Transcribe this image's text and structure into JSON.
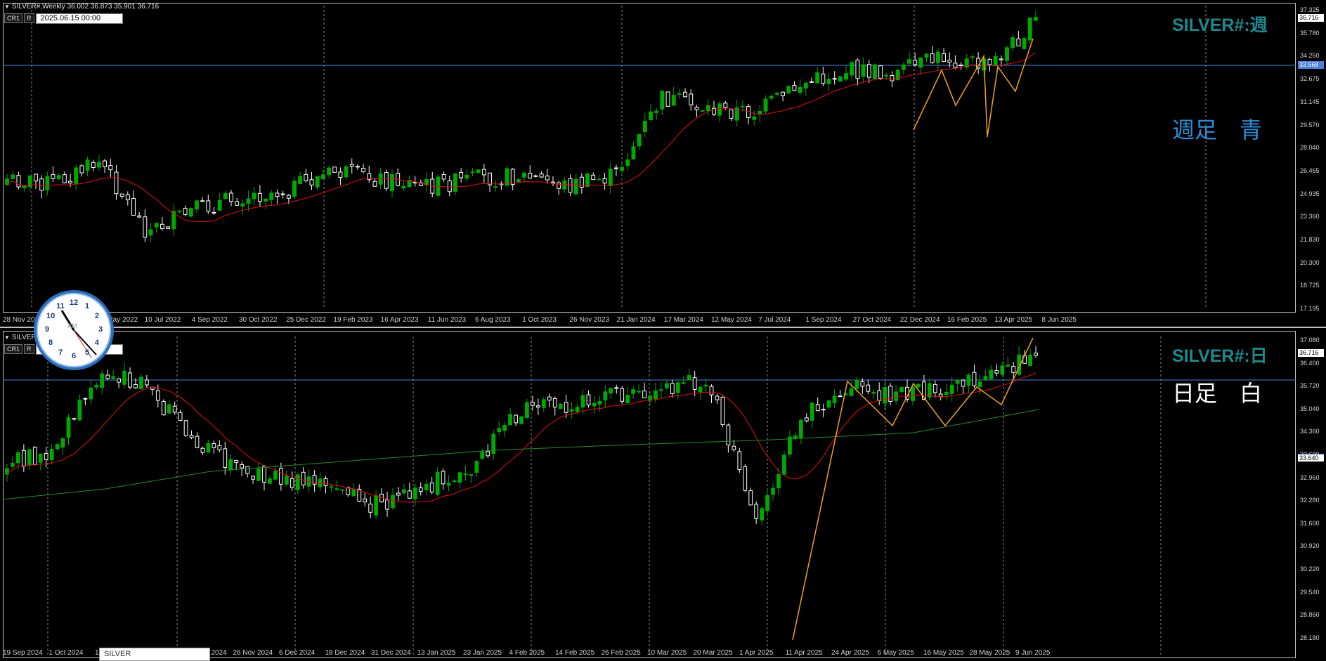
{
  "weekly": {
    "header": "SILVER#,Weekly  36.002 36.873 35.901 36.716",
    "buttons": [
      "CR1",
      "R"
    ],
    "date_input": "2025.06.15 00:00",
    "title_tag": "SILVER#:週",
    "note": "週足　青",
    "note_color": "#2b8cd6",
    "price_labels": [
      "37.325",
      "35.780",
      "34.250",
      "32.675",
      "31.145",
      "29.570",
      "28.040",
      "26.465",
      "24.935",
      "23.360",
      "21.830",
      "20.300",
      "18.725",
      "17.195"
    ],
    "price_tags": [
      "36.716",
      "33.568"
    ],
    "time_labels": [
      "28 Nov 2021",
      "2022",
      "15 May 2022",
      "10 Jul 2022",
      "4 Sep 2022",
      "30 Oct 2022",
      "25 Dec 2022",
      "19 Feb 2023",
      "16 Apr 2023",
      "11 Jun 2023",
      "6 Aug 2023",
      "1 Oct 2023",
      "26 Nov 2023",
      "21 Jan 2024",
      "17 Mar 2024",
      "12 May 2024",
      "7 Jul 2024",
      "1 Sep 2024",
      "27 Oct 2024",
      "22 Dec 2024",
      "16 Feb 2025",
      "13 Apr 2025",
      "8 Jun 2025"
    ]
  },
  "daily": {
    "header": "SILVER#,Daily  35.901 36.716",
    "buttons": [
      "CR1",
      "R"
    ],
    "date_input": "2025.06.10",
    "title_tag": "SILVER#:日",
    "note": "日足　白",
    "note_color": "#ffffff",
    "price_labels": [
      "37.080",
      "36.400",
      "35.720",
      "35.040",
      "34.360",
      "33.680",
      "32.960",
      "32.280",
      "31.600",
      "30.920",
      "30.220",
      "29.540",
      "28.860",
      "28.180"
    ],
    "price_tags": [
      "36.716",
      "33.640"
    ],
    "time_labels": [
      "19 Sep 2024",
      "1 Oct 2024",
      "11",
      "4",
      "14 Nov 2024",
      "26 Nov 2024",
      "6 Dec 2024",
      "18 Dec 2024",
      "31 Dec 2024",
      "13 Jan 2025",
      "23 Jan 2025",
      "4 Feb 2025",
      "14 Feb 2025",
      "26 Feb 2025",
      "10 Mar 2025",
      "20 Mar 2025",
      "1 Apr 2025",
      "11 Apr 2025",
      "24 Apr 2025",
      "6 May 2025",
      "16 May 2025",
      "28 May 2025",
      "9 Jun 2025"
    ]
  },
  "clock": {
    "numbers": [
      "12",
      "1",
      "2",
      "3",
      "4",
      "5",
      "6",
      "7",
      "8",
      "9",
      "10",
      "11"
    ],
    "ampm": "AM"
  },
  "tooltip": {
    "text": "SILVER"
  },
  "colors": {
    "bull": "#00a800",
    "bear": "#ffffff",
    "ma": "#e01010",
    "ma_long": "#2a8a2a",
    "zigzag": "#f0a020",
    "hline": "#4a7fd8"
  }
}
